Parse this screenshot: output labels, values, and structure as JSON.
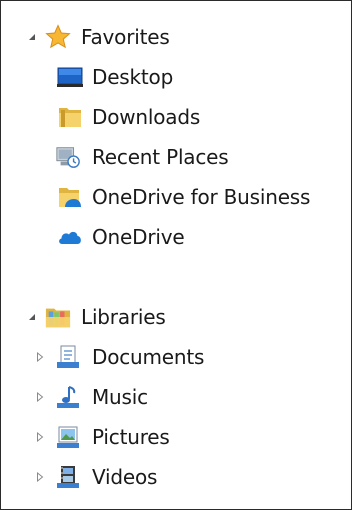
{
  "favorites": {
    "label": "Favorites",
    "items": [
      {
        "label": "Desktop",
        "icon": "desktop-icon"
      },
      {
        "label": "Downloads",
        "icon": "downloads-folder-icon"
      },
      {
        "label": "Recent Places",
        "icon": "recent-places-icon"
      },
      {
        "label": "OneDrive for Business",
        "icon": "onedrive-for-business-icon"
      },
      {
        "label": "OneDrive",
        "icon": "onedrive-cloud-icon"
      }
    ]
  },
  "libraries": {
    "label": "Libraries",
    "items": [
      {
        "label": "Documents",
        "icon": "documents-library-icon"
      },
      {
        "label": "Music",
        "icon": "music-library-icon"
      },
      {
        "label": "Pictures",
        "icon": "pictures-library-icon"
      },
      {
        "label": "Videos",
        "icon": "videos-library-icon"
      }
    ]
  },
  "colors": {
    "border": "#2b2b2b",
    "text": "#1a1a1a",
    "folder_yellow": "#f2c94c",
    "onedrive_blue": "#1f7ad6",
    "star_gold": "#f7b733"
  }
}
